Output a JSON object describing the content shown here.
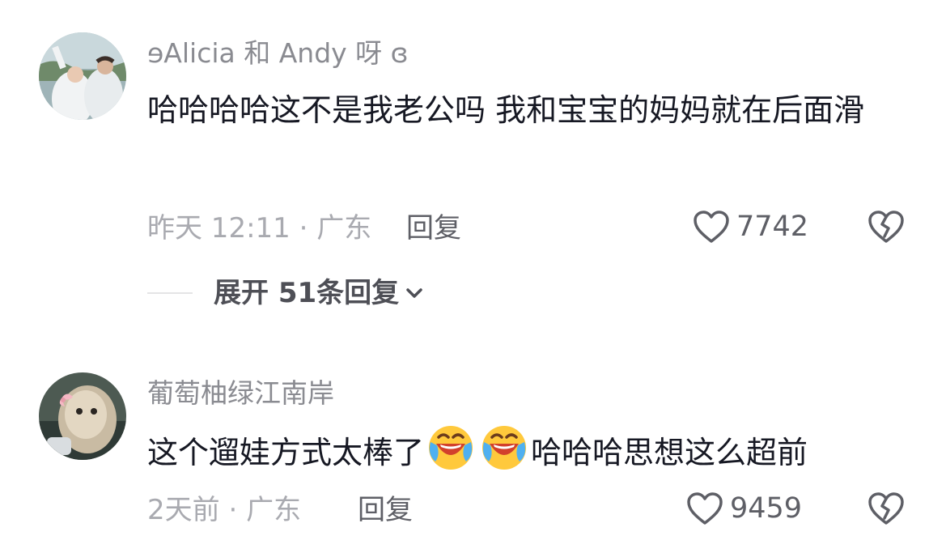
{
  "comments": [
    {
      "username": "ɘAlicia 和 Andy 呀 ɞ",
      "text": "哈哈哈哈这不是我老公吗 我和宝宝的妈妈就在后面滑",
      "time": "昨天 12:11",
      "separator": "·",
      "location": "广东",
      "reply_label": "回复",
      "likes": "7742",
      "expand_label": "展开 51条回复"
    },
    {
      "username": "葡萄柚绿江南岸",
      "text_before": "这个遛娃方式太棒了",
      "emoji_name": "laughing-crying-emoji",
      "text_after": "哈哈哈思想这么超前",
      "time": "2天前",
      "separator": "·",
      "location": "广东",
      "reply_label": "回复",
      "likes": "9459"
    }
  ],
  "colors": {
    "username": "#8a8b91",
    "text": "#161823",
    "meta": "#a9aab0",
    "action": "#5e5f66"
  },
  "icons": {
    "like": "heart-outline-icon",
    "dislike": "broken-heart-icon",
    "expand": "chevron-down-icon"
  }
}
